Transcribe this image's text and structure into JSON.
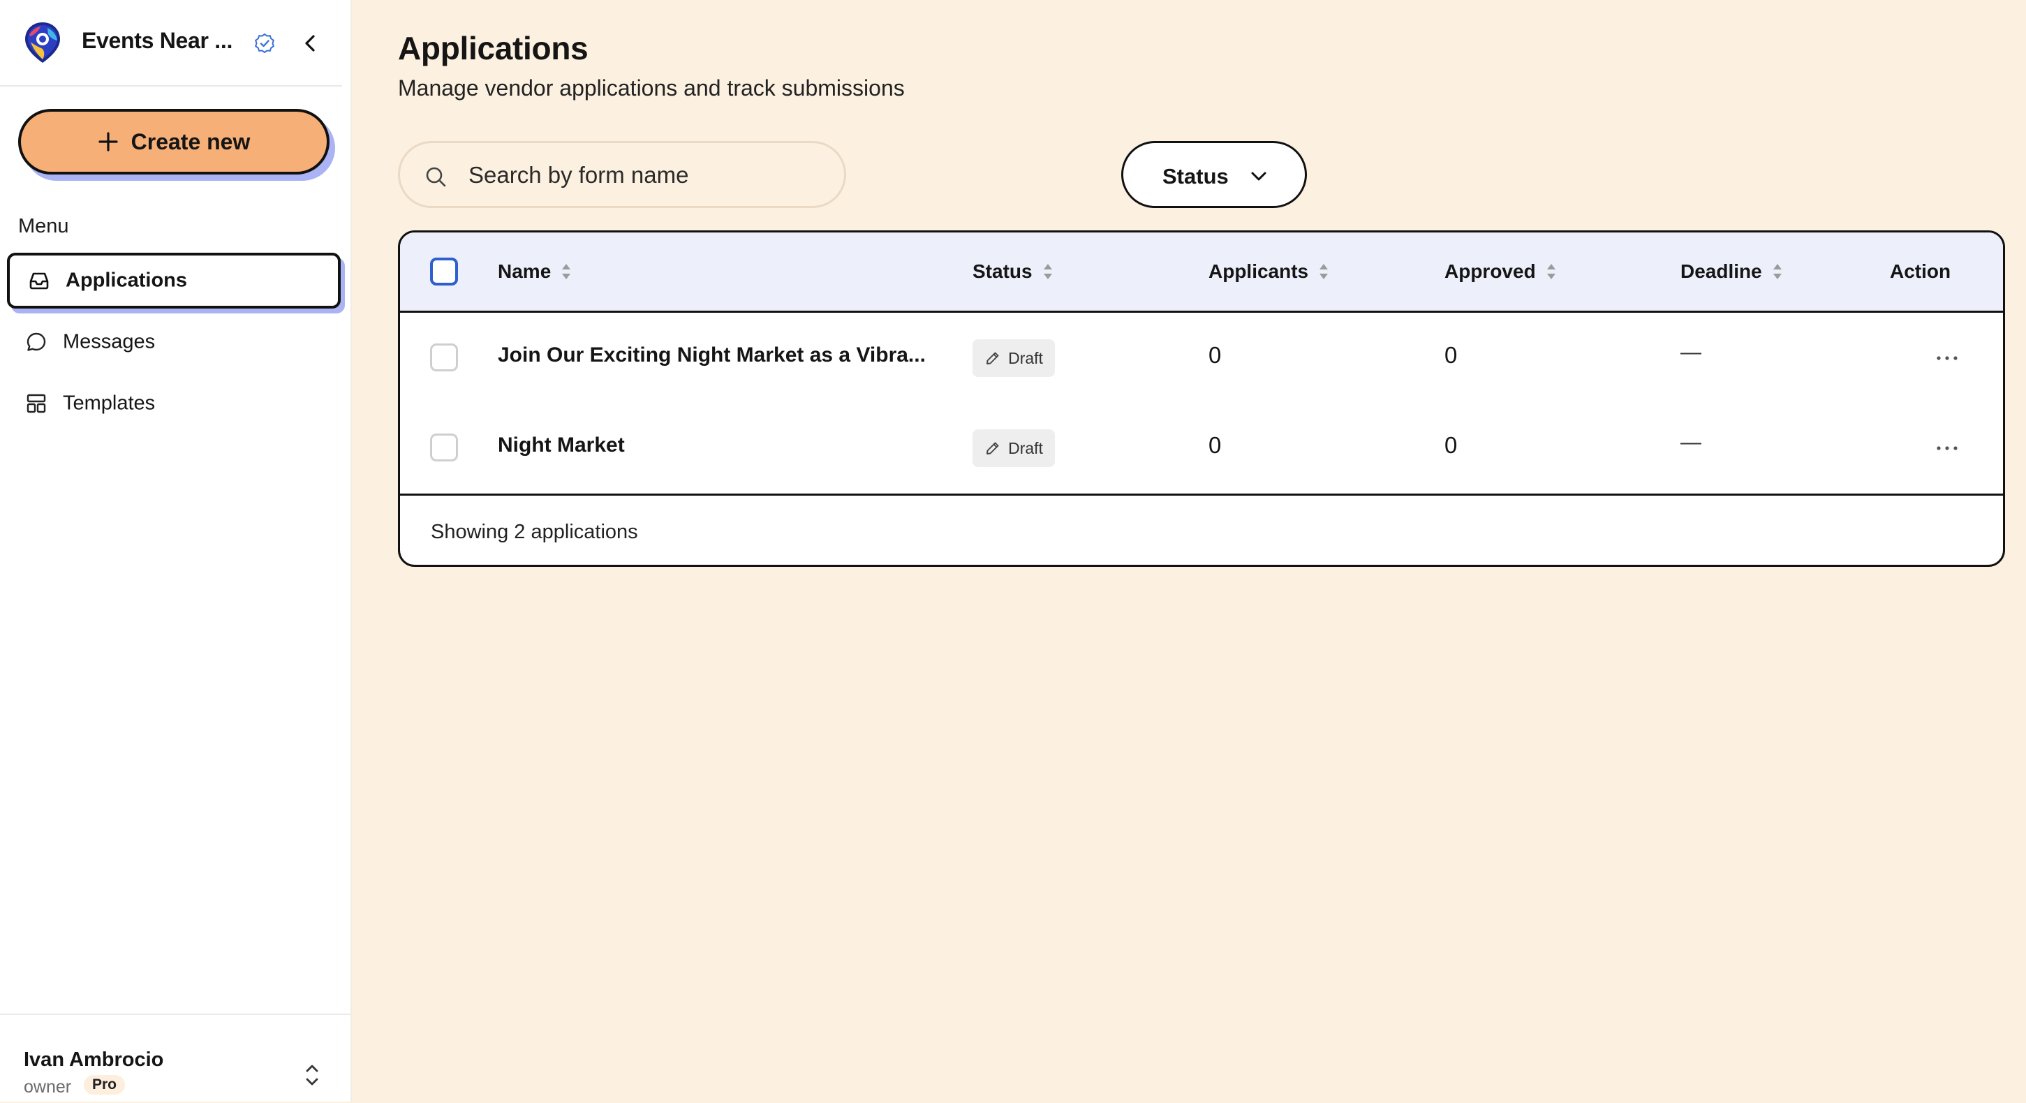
{
  "sidebar": {
    "brand_name": "Events Near ...",
    "create_label": "Create new",
    "menu_heading": "Menu",
    "items": [
      {
        "label": "Applications",
        "icon": "inbox-icon",
        "active": true
      },
      {
        "label": "Messages",
        "icon": "message-circle-icon",
        "active": false
      },
      {
        "label": "Templates",
        "icon": "layout-template-icon",
        "active": false
      }
    ],
    "profile": {
      "name": "Ivan Ambrocio",
      "role": "owner",
      "plan": "Pro"
    }
  },
  "main": {
    "title": "Applications",
    "subtitle": "Manage vendor applications and track submissions",
    "search": {
      "placeholder": "Search by form name",
      "value": ""
    },
    "status_filter": {
      "label": "Status"
    }
  },
  "table": {
    "columns": [
      "Name",
      "Status",
      "Applicants",
      "Approved",
      "Deadline",
      "Action"
    ],
    "rows": [
      {
        "name": "Join Our Exciting Night Market as a Vibra...",
        "status": "Draft",
        "applicants": "0",
        "approved": "0",
        "deadline": "—"
      },
      {
        "name": "Night Market",
        "status": "Draft",
        "applicants": "0",
        "approved": "0",
        "deadline": "—"
      }
    ],
    "footer": "Showing 2 applications"
  },
  "colors": {
    "page_background": "#fcf0e0",
    "create_button": "#f6b077",
    "accent_shadow": "#aab3f4",
    "table_header": "#edf0fb",
    "checkbox_accent": "#2f5fcf"
  }
}
